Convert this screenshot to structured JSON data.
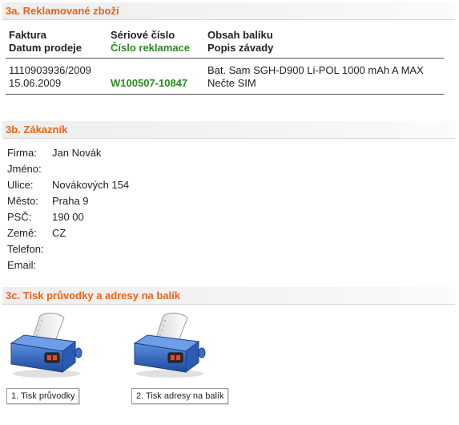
{
  "sections": {
    "returned_goods": {
      "title": "3a. Reklamované zboží"
    },
    "customer": {
      "title": "3b. Zákazník"
    },
    "print": {
      "title": "3c. Tisk průvodky a adresy na balík"
    }
  },
  "goods_table": {
    "col1": {
      "h1": "Faktura",
      "h2": "Datum prodeje"
    },
    "col2": {
      "h1": "Sériové číslo",
      "h2": "Číslo reklamace"
    },
    "col3": {
      "h1": "Obsah balíku",
      "h2": "Popis závady"
    },
    "row": {
      "invoice": "1110903936/2009",
      "sale_date": "15.06.2009",
      "serial_number": "",
      "claim_number": "W100507-10847",
      "package_content": "Bat. Sam SGH-D900 Li-POL 1000 mAh A MAX",
      "defect_description": "Nečte SIM"
    }
  },
  "customer": {
    "firm": {
      "label": "Firma:",
      "value": "Jan Novák"
    },
    "name": {
      "label": "Jméno:",
      "value": ""
    },
    "street": {
      "label": "Ulice:",
      "value": "Novákových 154"
    },
    "city": {
      "label": "Město:",
      "value": "Praha 9"
    },
    "zip": {
      "label": "PSČ:",
      "value": "190 00"
    },
    "country": {
      "label": "Země:",
      "value": "CZ"
    },
    "phone": {
      "label": "Telefon:",
      "value": ""
    },
    "email": {
      "label": "Email:",
      "value": ""
    }
  },
  "print": {
    "buttons": [
      {
        "label": "1. Tisk průvodky",
        "icon": "printer-icon"
      },
      {
        "label": "2. Tisk adresy na balík",
        "icon": "printer-icon"
      }
    ]
  },
  "colors": {
    "section_title": "#e8641b",
    "claim_green": "#2a8a1e",
    "printer_blue": "#2f5fae"
  }
}
